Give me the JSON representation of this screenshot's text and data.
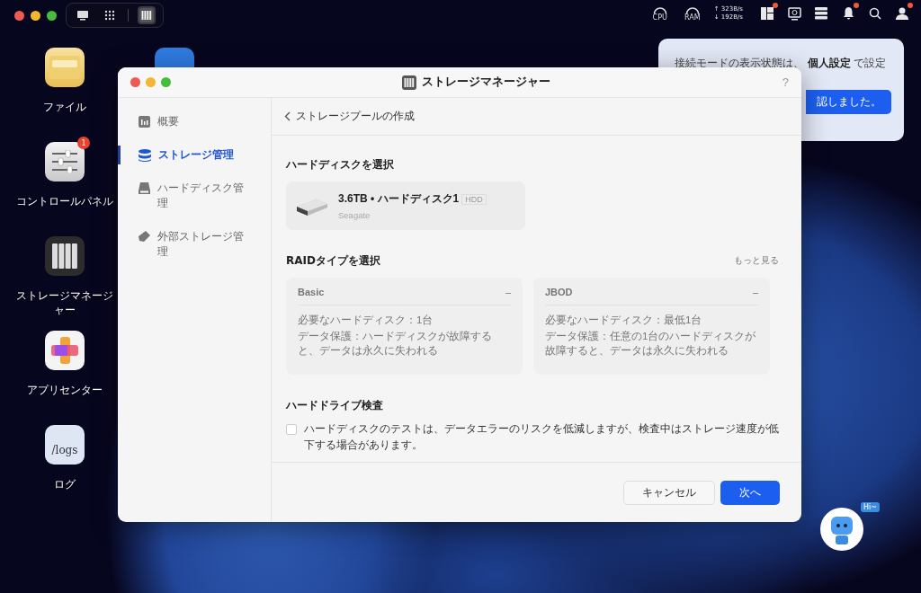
{
  "top_bar": {
    "pill_icons": [
      {
        "kind": "monitor",
        "selected": false
      },
      {
        "kind": "grid",
        "selected": false
      },
      {
        "kind": "storage",
        "selected": true
      }
    ],
    "cpu_label": "CPU",
    "ram_label": "RAM",
    "upload": "↑ 323B/s",
    "download": "↓ 192B/s",
    "tray_icons": [
      {
        "kind": "panel",
        "badge": true
      },
      {
        "kind": "display",
        "badge": false
      },
      {
        "kind": "servers",
        "badge": false
      },
      {
        "kind": "bell",
        "badge": true
      },
      {
        "kind": "search",
        "badge": false
      },
      {
        "kind": "user",
        "badge": true
      }
    ]
  },
  "desktop_icons": [
    {
      "kind": "folder",
      "label": "ファイル"
    },
    {
      "kind": "control",
      "label": "コントロールパネル",
      "badge": "1"
    },
    {
      "kind": "storage",
      "label": "ストレージマネージャー"
    },
    {
      "kind": "apps",
      "label": "アプリセンター"
    },
    {
      "kind": "logs",
      "label": "ログ",
      "icon_text": "/logs"
    }
  ],
  "popover": {
    "text": "接続モードの表示状態は、 **個人設定** で設定",
    "button": "認しました。"
  },
  "window": {
    "title": "ストレージマネージャー",
    "help": "?",
    "sidebar": [
      {
        "kind": "overview",
        "label": "概要",
        "selected": false
      },
      {
        "kind": "storage",
        "label": "ストレージ管理",
        "selected": true
      },
      {
        "kind": "disk",
        "label": "ハードディスク管理",
        "selected": false
      },
      {
        "kind": "external",
        "label": "外部ストレージ管理",
        "selected": false
      }
    ],
    "header": "ストレージプールの作成",
    "disk_section": {
      "heading": "ハードディスクを選択",
      "disk": {
        "name": "3.6TB • ハードディスク1",
        "tag": "HDD",
        "vendor": "Seagate"
      }
    },
    "raid_section": {
      "heading": "RAIDタイプを選択",
      "more": "もっと見る",
      "options": [
        {
          "name": "Basic",
          "mark": "–",
          "disabled": true,
          "required": "必要なハードディスク：1台",
          "protection": "データ保護：ハードディスクが故障すると、データは永久に失われる"
        },
        {
          "name": "JBOD",
          "mark": "–",
          "disabled": true,
          "required": "必要なハードディスク：最低1台",
          "protection": "データ保護：任意の1台のハードディスクが故障すると、データは永久に失われる"
        }
      ]
    },
    "check_section": {
      "heading": "ハードドライブ検査",
      "checked": false,
      "text": "ハードディスクのテストは、データエラーのリスクを低減しますが、検査中はストレージ速度が低下する場合があります。"
    },
    "buttons": {
      "cancel": "キャンセル",
      "next": "次へ"
    }
  },
  "assistant": {
    "bubble": "Hi~"
  }
}
